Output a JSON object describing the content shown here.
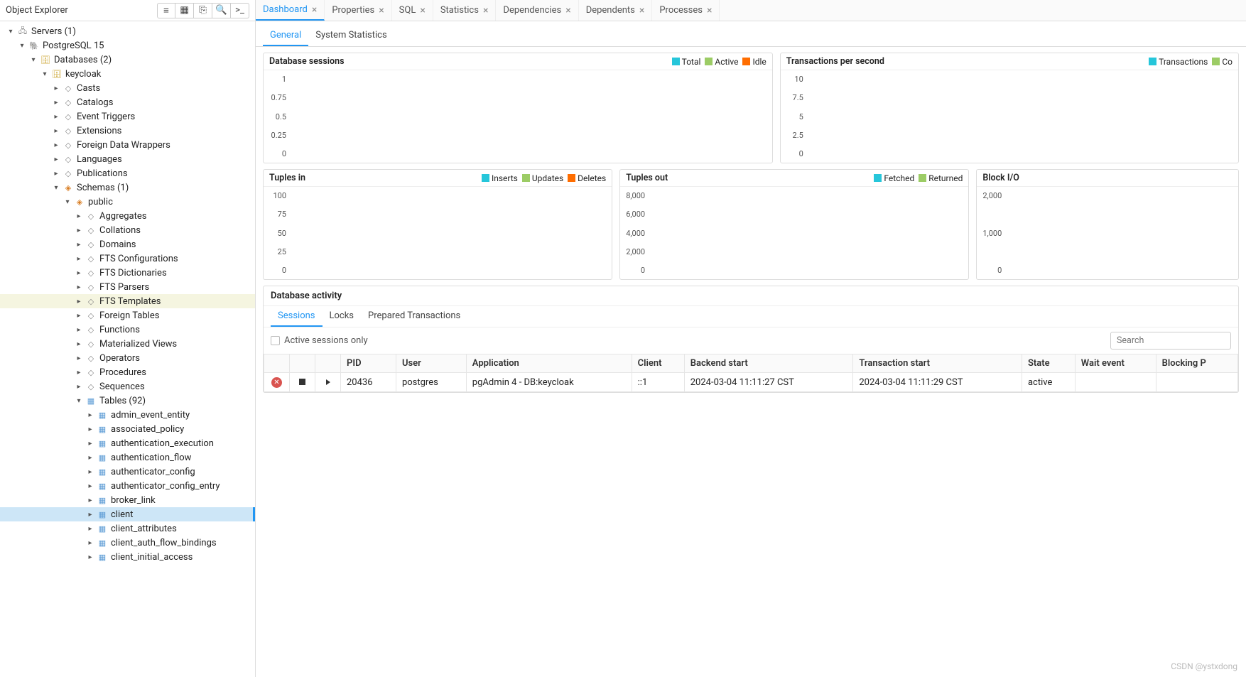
{
  "sidebar": {
    "title": "Object Explorer",
    "tree": [
      {
        "pad": 8,
        "chev": "down",
        "icon": "server",
        "cls": "ico-server",
        "label": "Servers (1)"
      },
      {
        "pad": 24,
        "chev": "down",
        "icon": "pg",
        "cls": "ico-pg",
        "label": "PostgreSQL 15"
      },
      {
        "pad": 40,
        "chev": "down",
        "icon": "db",
        "cls": "ico-db",
        "label": "Databases (2)"
      },
      {
        "pad": 56,
        "chev": "down",
        "icon": "db",
        "cls": "ico-db",
        "label": "keycloak"
      },
      {
        "pad": 72,
        "chev": "right",
        "icon": "gen",
        "cls": "ico-gen",
        "label": "Casts"
      },
      {
        "pad": 72,
        "chev": "right",
        "icon": "gen",
        "cls": "ico-gen",
        "label": "Catalogs"
      },
      {
        "pad": 72,
        "chev": "right",
        "icon": "gen",
        "cls": "ico-gen",
        "label": "Event Triggers"
      },
      {
        "pad": 72,
        "chev": "right",
        "icon": "gen",
        "cls": "ico-gen",
        "label": "Extensions"
      },
      {
        "pad": 72,
        "chev": "right",
        "icon": "gen",
        "cls": "ico-gen",
        "label": "Foreign Data Wrappers"
      },
      {
        "pad": 72,
        "chev": "right",
        "icon": "gen",
        "cls": "ico-gen",
        "label": "Languages"
      },
      {
        "pad": 72,
        "chev": "right",
        "icon": "gen",
        "cls": "ico-gen",
        "label": "Publications"
      },
      {
        "pad": 72,
        "chev": "down",
        "icon": "schema",
        "cls": "ico-schema",
        "label": "Schemas (1)"
      },
      {
        "pad": 88,
        "chev": "down",
        "icon": "schema",
        "cls": "ico-schema",
        "label": "public"
      },
      {
        "pad": 104,
        "chev": "right",
        "icon": "gen",
        "cls": "ico-gen",
        "label": "Aggregates"
      },
      {
        "pad": 104,
        "chev": "right",
        "icon": "gen",
        "cls": "ico-gen",
        "label": "Collations"
      },
      {
        "pad": 104,
        "chev": "right",
        "icon": "gen",
        "cls": "ico-gen",
        "label": "Domains"
      },
      {
        "pad": 104,
        "chev": "right",
        "icon": "gen",
        "cls": "ico-gen",
        "label": "FTS Configurations"
      },
      {
        "pad": 104,
        "chev": "right",
        "icon": "gen",
        "cls": "ico-gen",
        "label": "FTS Dictionaries"
      },
      {
        "pad": 104,
        "chev": "right",
        "icon": "gen",
        "cls": "ico-gen",
        "label": "FTS Parsers"
      },
      {
        "pad": 104,
        "chev": "right",
        "icon": "gen",
        "cls": "ico-gen",
        "label": "FTS Templates",
        "hl": true
      },
      {
        "pad": 104,
        "chev": "right",
        "icon": "gen",
        "cls": "ico-gen",
        "label": "Foreign Tables"
      },
      {
        "pad": 104,
        "chev": "right",
        "icon": "gen",
        "cls": "ico-gen",
        "label": "Functions"
      },
      {
        "pad": 104,
        "chev": "right",
        "icon": "gen",
        "cls": "ico-gen",
        "label": "Materialized Views"
      },
      {
        "pad": 104,
        "chev": "right",
        "icon": "gen",
        "cls": "ico-gen",
        "label": "Operators"
      },
      {
        "pad": 104,
        "chev": "right",
        "icon": "gen",
        "cls": "ico-gen",
        "label": "Procedures"
      },
      {
        "pad": 104,
        "chev": "right",
        "icon": "gen",
        "cls": "ico-gen",
        "label": "Sequences"
      },
      {
        "pad": 104,
        "chev": "down",
        "icon": "table",
        "cls": "ico-table",
        "label": "Tables (92)"
      },
      {
        "pad": 120,
        "chev": "right",
        "icon": "table",
        "cls": "ico-table",
        "label": "admin_event_entity"
      },
      {
        "pad": 120,
        "chev": "right",
        "icon": "table",
        "cls": "ico-table",
        "label": "associated_policy"
      },
      {
        "pad": 120,
        "chev": "right",
        "icon": "table",
        "cls": "ico-table",
        "label": "authentication_execution"
      },
      {
        "pad": 120,
        "chev": "right",
        "icon": "table",
        "cls": "ico-table",
        "label": "authentication_flow"
      },
      {
        "pad": 120,
        "chev": "right",
        "icon": "table",
        "cls": "ico-table",
        "label": "authenticator_config"
      },
      {
        "pad": 120,
        "chev": "right",
        "icon": "table",
        "cls": "ico-table",
        "label": "authenticator_config_entry"
      },
      {
        "pad": 120,
        "chev": "right",
        "icon": "table",
        "cls": "ico-table",
        "label": "broker_link"
      },
      {
        "pad": 120,
        "chev": "right",
        "icon": "table",
        "cls": "ico-table",
        "label": "client",
        "selected": true
      },
      {
        "pad": 120,
        "chev": "right",
        "icon": "table",
        "cls": "ico-table",
        "label": "client_attributes"
      },
      {
        "pad": 120,
        "chev": "right",
        "icon": "table",
        "cls": "ico-table",
        "label": "client_auth_flow_bindings"
      },
      {
        "pad": 120,
        "chev": "right",
        "icon": "table",
        "cls": "ico-table",
        "label": "client_initial_access"
      }
    ]
  },
  "tabs": [
    {
      "label": "Dashboard",
      "active": true
    },
    {
      "label": "Properties"
    },
    {
      "label": "SQL"
    },
    {
      "label": "Statistics"
    },
    {
      "label": "Dependencies"
    },
    {
      "label": "Dependents"
    },
    {
      "label": "Processes"
    }
  ],
  "subtabs": [
    {
      "label": "General",
      "active": true
    },
    {
      "label": "System Statistics"
    }
  ],
  "charts": {
    "sessions": {
      "title": "Database sessions",
      "legend": [
        {
          "c": "#26c6da",
          "l": "Total"
        },
        {
          "c": "#9ccc65",
          "l": "Active"
        },
        {
          "c": "#ff6d00",
          "l": "Idle"
        }
      ],
      "ticks": [
        "1",
        "0.75",
        "0.5",
        "0.25",
        "0"
      ]
    },
    "tps": {
      "title": "Transactions per second",
      "legend": [
        {
          "c": "#26c6da",
          "l": "Transactions"
        },
        {
          "c": "#9ccc65",
          "l": "Co"
        }
      ],
      "ticks": [
        "10",
        "7.5",
        "5",
        "2.5",
        "0"
      ]
    },
    "tin": {
      "title": "Tuples in",
      "legend": [
        {
          "c": "#26c6da",
          "l": "Inserts"
        },
        {
          "c": "#9ccc65",
          "l": "Updates"
        },
        {
          "c": "#ff6d00",
          "l": "Deletes"
        }
      ],
      "ticks": [
        "100",
        "75",
        "50",
        "25",
        "0"
      ]
    },
    "tout": {
      "title": "Tuples out",
      "legend": [
        {
          "c": "#26c6da",
          "l": "Fetched"
        },
        {
          "c": "#9ccc65",
          "l": "Returned"
        }
      ],
      "ticks": [
        "8,000",
        "6,000",
        "4,000",
        "2,000",
        "0"
      ]
    },
    "bio": {
      "title": "Block I/O",
      "legend": [],
      "ticks": [
        "2,000",
        "1,000",
        "0"
      ]
    }
  },
  "activity": {
    "title": "Database activity",
    "tabs": [
      {
        "label": "Sessions",
        "active": true
      },
      {
        "label": "Locks"
      },
      {
        "label": "Prepared Transactions"
      }
    ],
    "filter": "Active sessions only",
    "search_placeholder": "Search",
    "columns": [
      "",
      "",
      "",
      "PID",
      "User",
      "Application",
      "Client",
      "Backend start",
      "Transaction start",
      "State",
      "Wait event",
      "Blocking P"
    ],
    "rows": [
      {
        "pid": "20436",
        "user": "postgres",
        "app": "pgAdmin 4 - DB:keycloak",
        "client": "::1",
        "backend": "2024-03-04 11:11:27 CST",
        "txn": "2024-03-04 11:11:29 CST",
        "state": "active",
        "wait": "",
        "block": ""
      }
    ]
  },
  "watermark": "CSDN @ystxdong",
  "chart_data": [
    {
      "type": "line",
      "title": "Database sessions",
      "ylim": [
        0,
        1
      ],
      "series": [
        {
          "name": "Total",
          "values": []
        },
        {
          "name": "Active",
          "values": []
        },
        {
          "name": "Idle",
          "values": []
        }
      ]
    },
    {
      "type": "line",
      "title": "Transactions per second",
      "ylim": [
        0,
        10
      ],
      "series": [
        {
          "name": "Transactions",
          "values": []
        }
      ]
    },
    {
      "type": "line",
      "title": "Tuples in",
      "ylim": [
        0,
        100
      ],
      "series": [
        {
          "name": "Inserts",
          "values": []
        },
        {
          "name": "Updates",
          "values": []
        },
        {
          "name": "Deletes",
          "values": []
        }
      ]
    },
    {
      "type": "line",
      "title": "Tuples out",
      "ylim": [
        0,
        8000
      ],
      "series": [
        {
          "name": "Fetched",
          "values": []
        },
        {
          "name": "Returned",
          "values": []
        }
      ]
    },
    {
      "type": "line",
      "title": "Block I/O",
      "ylim": [
        0,
        2000
      ],
      "series": []
    }
  ]
}
